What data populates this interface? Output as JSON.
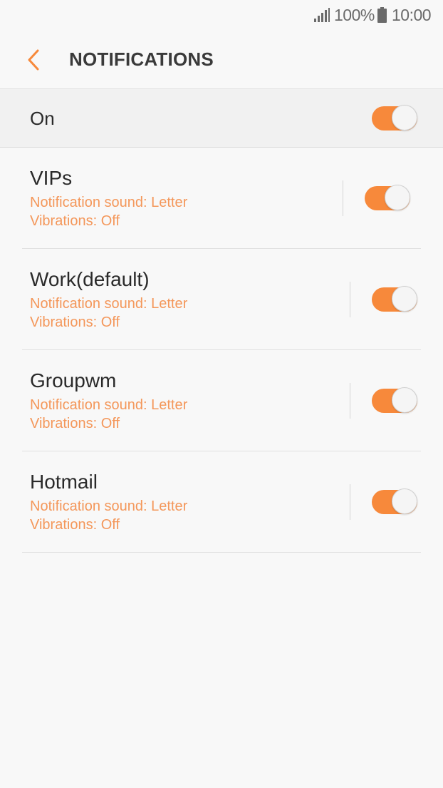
{
  "status_bar": {
    "battery_percent": "100%",
    "time": "10:00",
    "signal_icon": "signal-bars-icon",
    "battery_icon": "battery-full-icon"
  },
  "header": {
    "back_icon": "chevron-left-icon",
    "title": "NOTIFICATIONS"
  },
  "master_switch": {
    "label": "On",
    "enabled": true
  },
  "accounts": [
    {
      "name": "VIPs",
      "sound": "Notification sound: Letter",
      "vibration": "Vibrations: Off",
      "enabled": true
    },
    {
      "name": "Work(default)",
      "sound": "Notification sound: Letter",
      "vibration": "Vibrations: Off",
      "enabled": true
    },
    {
      "name": "Groupwm",
      "sound": "Notification sound: Letter",
      "vibration": "Vibrations: Off",
      "enabled": true
    },
    {
      "name": "Hotmail",
      "sound": "Notification sound: Letter",
      "vibration": "Vibrations: Off",
      "enabled": true
    }
  ],
  "colors": {
    "accent": "#f7893b",
    "detail_text": "#f4975a",
    "background": "#f8f8f8"
  }
}
